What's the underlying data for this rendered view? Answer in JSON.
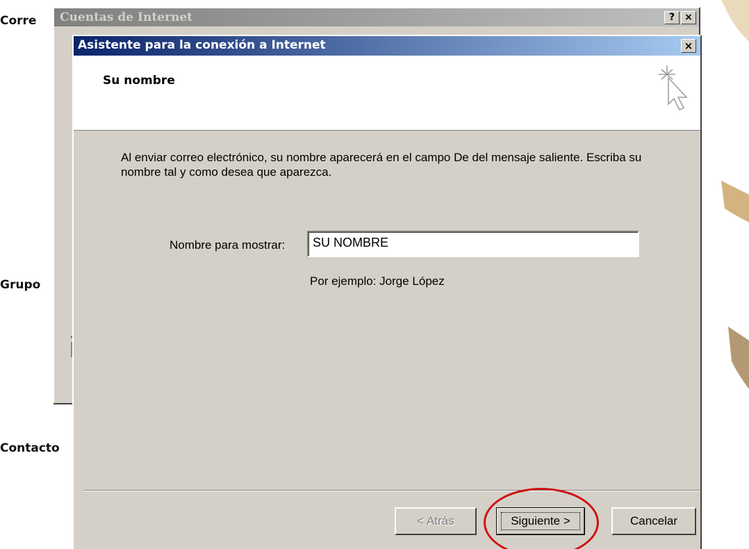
{
  "background": {
    "labels": [
      "Corre",
      "Grupo",
      "Contacto"
    ]
  },
  "back_window": {
    "title": "Cuentas de Internet",
    "help_button": "?",
    "close_button": "×"
  },
  "wizard": {
    "title": "Asistente para la conexión a Internet",
    "close_button": "×",
    "header_title": "Su nombre",
    "description": "Al enviar correo electrónico, su nombre aparecerá en el campo De del mensaje saliente. Escriba su nombre tal y como desea que aparezca.",
    "field_label": "Nombre para mostrar:",
    "field_value": "SU NOMBRE",
    "example_text": "Por ejemplo: Jorge López",
    "buttons": {
      "back": "< Atrás",
      "next": "Siguiente >",
      "cancel": "Cancelar"
    }
  },
  "colors": {
    "title_active_start": "#0a246a",
    "title_active_end": "#a6caf0",
    "face": "#d4d0c8",
    "annotation": "#d01010"
  },
  "icons": {
    "wizard_header": "sparkle-cursor-icon"
  }
}
